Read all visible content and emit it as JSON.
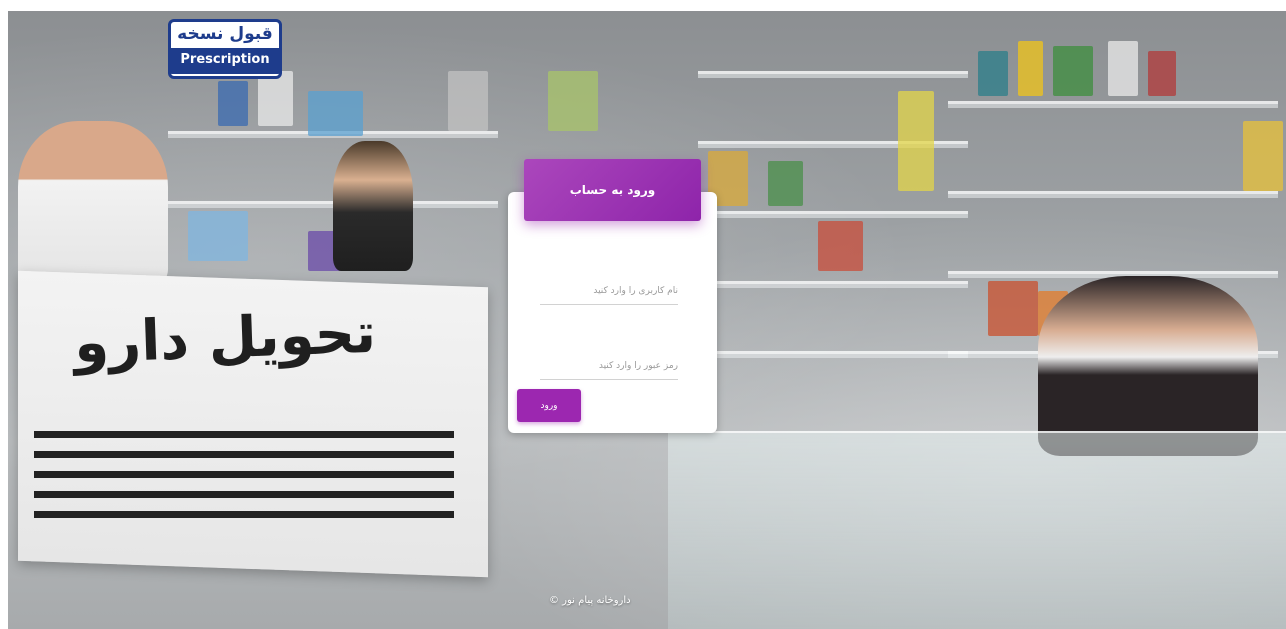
{
  "background": {
    "counter_sign": "تحویل دارو",
    "rx_sign_fa": "قبول نسخه",
    "rx_sign_en": "Prescription"
  },
  "login": {
    "title": "ورود به حساب",
    "username_placeholder": "نام کاربری را وارد کنید",
    "password_placeholder": "رمز عبور را وارد کنید",
    "submit_label": "ورود"
  },
  "footer": {
    "copyright": "داروخانه پیام نور ©"
  },
  "colors": {
    "accent": "#9c27b0",
    "header_gradient_start": "#ab47bc",
    "header_gradient_end": "#8e24aa"
  }
}
